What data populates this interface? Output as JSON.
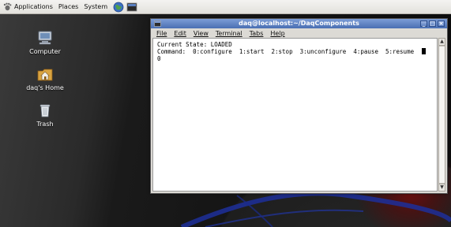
{
  "top_panel": {
    "applications_label": "Applications",
    "places_label": "Places",
    "system_label": "System"
  },
  "desktop": {
    "icons": [
      {
        "label": "Computer",
        "icon": "computer-icon"
      },
      {
        "label": "daq's Home",
        "icon": "home-folder-icon"
      },
      {
        "label": "Trash",
        "icon": "trash-icon"
      }
    ]
  },
  "terminal": {
    "title": "daq@localhost:~/DaqComponents",
    "menu": [
      "File",
      "Edit",
      "View",
      "Terminal",
      "Tabs",
      "Help"
    ],
    "lines": [
      "Current State: LOADED",
      "Command:  0:configure  1:start  2:stop  3:unconfigure  4:pause  5:resume",
      "0"
    ],
    "controls": {
      "minimize": "_",
      "maximize": "□",
      "close": "×"
    }
  },
  "colors": {
    "titlebar": "#5b7fc2",
    "panel": "#e8e6e1",
    "desktop_red_glow": "#6b0d0d",
    "swirl_blue": "#1d2f9a"
  }
}
